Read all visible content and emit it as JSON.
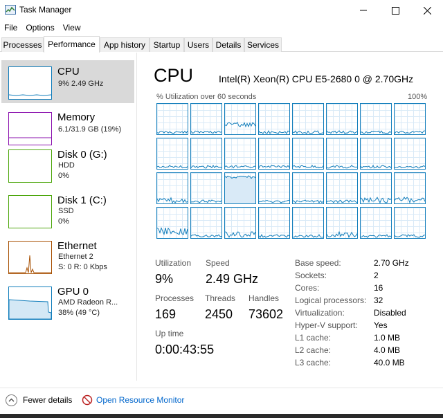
{
  "window": {
    "title": "Task Manager"
  },
  "menu": [
    "File",
    "Options",
    "View"
  ],
  "tabs": [
    "Processes",
    "Performance",
    "App history",
    "Startup",
    "Users",
    "Details",
    "Services"
  ],
  "active_tab": "Performance",
  "sidebar": [
    {
      "title": "CPU",
      "line1": "9%  2.49 GHz",
      "line2": "",
      "color": "#117dbb"
    },
    {
      "title": "Memory",
      "line1": "6.1/31.9 GB (19%)",
      "line2": "",
      "color": "#8b12ae"
    },
    {
      "title": "Disk 0 (G:)",
      "line1": "HDD",
      "line2": "0%",
      "color": "#4da60c"
    },
    {
      "title": "Disk 1 (C:)",
      "line1": "SSD",
      "line2": "0%",
      "color": "#4da60c"
    },
    {
      "title": "Ethernet",
      "line1": "Ethernet 2",
      "line2": "S: 0  R: 0 Kbps",
      "color": "#a74f01"
    },
    {
      "title": "GPU 0",
      "line1": "AMD Radeon R...",
      "line2": "38%  (49 °C)",
      "color": "#117dbb"
    }
  ],
  "main": {
    "title": "CPU",
    "model": "Intel(R) Xeon(R) CPU E5-2680 0 @ 2.70GHz",
    "graph_label": "% Utilization over 60 seconds",
    "graph_max": "100%",
    "logical_processor_count": 32
  },
  "stats": {
    "utilization_label": "Utilization",
    "utilization": "9%",
    "speed_label": "Speed",
    "speed": "2.49 GHz",
    "processes_label": "Processes",
    "processes": "169",
    "threads_label": "Threads",
    "threads": "2450",
    "handles_label": "Handles",
    "handles": "73602",
    "uptime_label": "Up time",
    "uptime": "0:00:43:55"
  },
  "specs": [
    {
      "label": "Base speed:",
      "value": "2.70 GHz"
    },
    {
      "label": "Sockets:",
      "value": "2"
    },
    {
      "label": "Cores:",
      "value": "16"
    },
    {
      "label": "Logical processors:",
      "value": "32"
    },
    {
      "label": "Virtualization:",
      "value": "Disabled"
    },
    {
      "label": "Hyper-V support:",
      "value": "Yes"
    },
    {
      "label": "L1 cache:",
      "value": "1.0 MB"
    },
    {
      "label": "L2 cache:",
      "value": "4.0 MB"
    },
    {
      "label": "L3 cache:",
      "value": "40.0 MB"
    }
  ],
  "footer": {
    "fewer_details": "Fewer details",
    "resource_monitor": "Open Resource Monitor"
  },
  "icons": {
    "app": "task-manager-icon",
    "minimize": "minimize-icon",
    "maximize": "maximize-icon",
    "close": "close-icon",
    "fewer": "chevron-up-icon",
    "monitor": "resource-monitor-icon"
  }
}
